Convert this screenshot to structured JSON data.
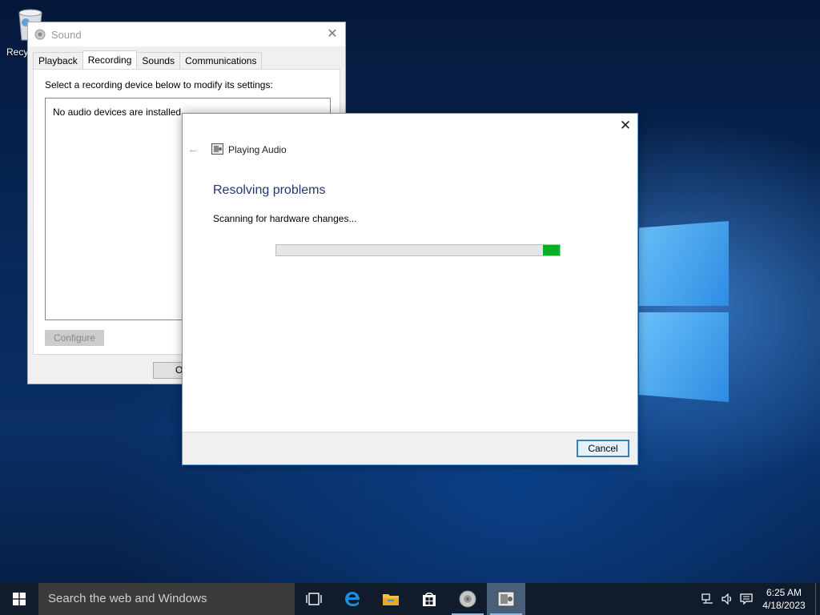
{
  "desktop": {
    "recycle_bin_label": "Recycle Bin"
  },
  "sound_dialog": {
    "title": "Sound",
    "tabs": [
      {
        "label": "Playback"
      },
      {
        "label": "Recording"
      },
      {
        "label": "Sounds"
      },
      {
        "label": "Communications"
      }
    ],
    "active_tab": "Recording",
    "instruction": "Select a recording device below to modify its settings:",
    "empty_message": "No audio devices are installed",
    "configure_label": "Configure",
    "ok_label": "OK"
  },
  "troubleshooter": {
    "app_title": "Playing Audio",
    "heading": "Resolving problems",
    "status": "Scanning for hardware changes...",
    "cancel_label": "Cancel",
    "progress_color": "#06b025"
  },
  "taskbar": {
    "search_placeholder": "Search the web and Windows",
    "clock_time": "6:25 AM",
    "clock_date": "4/18/2023"
  }
}
